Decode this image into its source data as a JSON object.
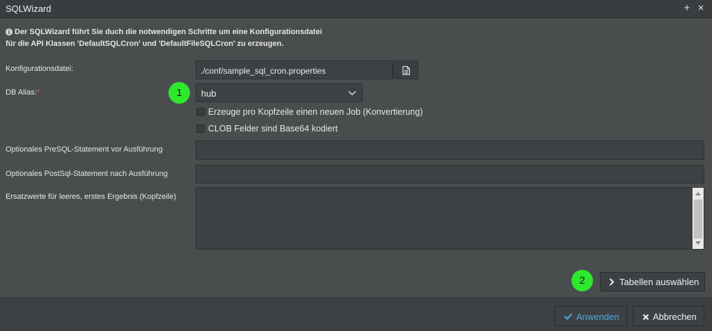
{
  "window": {
    "title": "SQLWizard",
    "maximize_label": "+",
    "close_label": "×"
  },
  "info": {
    "icon": "info-icon",
    "line1": "Der SQLWizard führt Sie duch die notwendigen Schritte um eine Konfigurationsdatei",
    "line2": "für die API Klassen 'DefaultSQLCron' und 'DefaultFileSQLCron' zu erzeugen."
  },
  "form": {
    "config_label": "Konfigurationsdatei:",
    "config_value": "./conf/sample_sql_cron.properties",
    "db_alias_label": "DB Alias:",
    "db_alias_required": "*",
    "db_alias_value": "hub",
    "checkbox_header_job": "Erzeuge pro Kopfzeile einen neuen Job (Konvertierung)",
    "checkbox_clob": "CLOB Felder sind Base64 kodiert",
    "pre_sql_label": "Optionales PreSQL-Statement vor Ausführung",
    "pre_sql_value": "",
    "post_sql_label": "Optionales PostSql-Statement nach Ausführung",
    "post_sql_value": "",
    "replacement_label": "Ersatzwerte für leeres, erstes Ergebnis (Kopfzeile)",
    "replacement_value": ""
  },
  "badges": {
    "one": "1",
    "two": "2"
  },
  "buttons": {
    "select_tables": "Tabellen auswählen",
    "apply": "Anwenden",
    "cancel": "Abbrechen"
  },
  "colors": {
    "background": "#4a4d4e",
    "badge": "#2ee82e",
    "apply_accent": "#4aa8e0"
  }
}
